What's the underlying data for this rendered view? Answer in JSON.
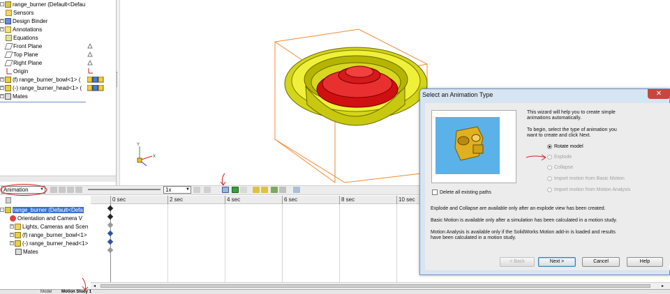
{
  "feature_tree": {
    "items": [
      {
        "label": "range_burner  (Default<Defau",
        "icon": "part-icon",
        "expand": "-"
      },
      {
        "label": "Sensors",
        "icon": "folder-icon",
        "expand": ""
      },
      {
        "label": "Design Binder",
        "icon": "book-icon",
        "expand": "+"
      },
      {
        "label": "Annotations",
        "icon": "annotation-icon",
        "expand": "+"
      },
      {
        "label": "Equations",
        "icon": "equation-icon",
        "expand": ""
      },
      {
        "label": "Front Plane",
        "icon": "plane-icon",
        "expand": ""
      },
      {
        "label": "Top Plane",
        "icon": "plane-icon",
        "expand": ""
      },
      {
        "label": "Right Plane",
        "icon": "plane-icon",
        "expand": ""
      },
      {
        "label": "Origin",
        "icon": "origin-icon",
        "expand": ""
      },
      {
        "label": "(f) range_burner_bowl<1> (",
        "icon": "component-icon",
        "expand": "+"
      },
      {
        "label": "(-) range_burner_head<1> (",
        "icon": "component-icon",
        "expand": "+"
      },
      {
        "label": "Mates",
        "icon": "mates-icon",
        "expand": "+"
      }
    ]
  },
  "motion_toolbar": {
    "study_type": "Animation",
    "speed": "1x"
  },
  "motion_tree": {
    "items": [
      {
        "label": "range_burner  (Default<Defa",
        "expand": "-"
      },
      {
        "label": "Orientation and Camera V",
        "expand": ""
      },
      {
        "label": "Lights, Cameras and Scen",
        "expand": "+"
      },
      {
        "label": "(f) range_burner_bowl<1>",
        "expand": "+"
      },
      {
        "label": "(-) range_burner_head<1>",
        "expand": "+"
      },
      {
        "label": "Mates",
        "expand": ""
      }
    ]
  },
  "timeline": {
    "ticks": [
      "0 sec",
      "2 sec",
      "4 sec",
      "6 sec",
      "8 sec",
      "10 sec"
    ]
  },
  "tabs": [
    "Model",
    "Motion Study 1"
  ],
  "dialog": {
    "title": "Select an Animation Type",
    "intro_1": "This wizard will help you to create simple",
    "intro_2": "animations automatically.",
    "instr_1": "To begin, select the type of animation you",
    "instr_2": "want to create and click Next.",
    "options": [
      {
        "label": "Rotate model",
        "selected": true,
        "enabled": true
      },
      {
        "label": "Explode",
        "selected": false,
        "enabled": false
      },
      {
        "label": "Collapse",
        "selected": false,
        "enabled": false
      },
      {
        "label": "Import motion from Basic Motion",
        "selected": false,
        "enabled": false
      },
      {
        "label": "Import motion from Motion Analysis",
        "selected": false,
        "enabled": false
      }
    ],
    "delete_paths": "Delete all existing paths",
    "note_1": "Explode and Collapse are available only after an explode view has been created.",
    "note_2": "Basic Motion is available only after a simulation has been calculated in a motion study.",
    "note_3a": "Motion Analysis is available only if the SolidWorks Motion add-in is loaded and results",
    "note_3b": "have been calculated in a motion study.",
    "back": "< Back",
    "next": "Next >",
    "cancel": "Cancel",
    "help": "Help",
    "close": "✕"
  },
  "colors": {
    "bowl": "#e3e31a",
    "head": "#e01010",
    "annotation_red": "#d42020",
    "selection_blue": "#3a6fd0"
  }
}
